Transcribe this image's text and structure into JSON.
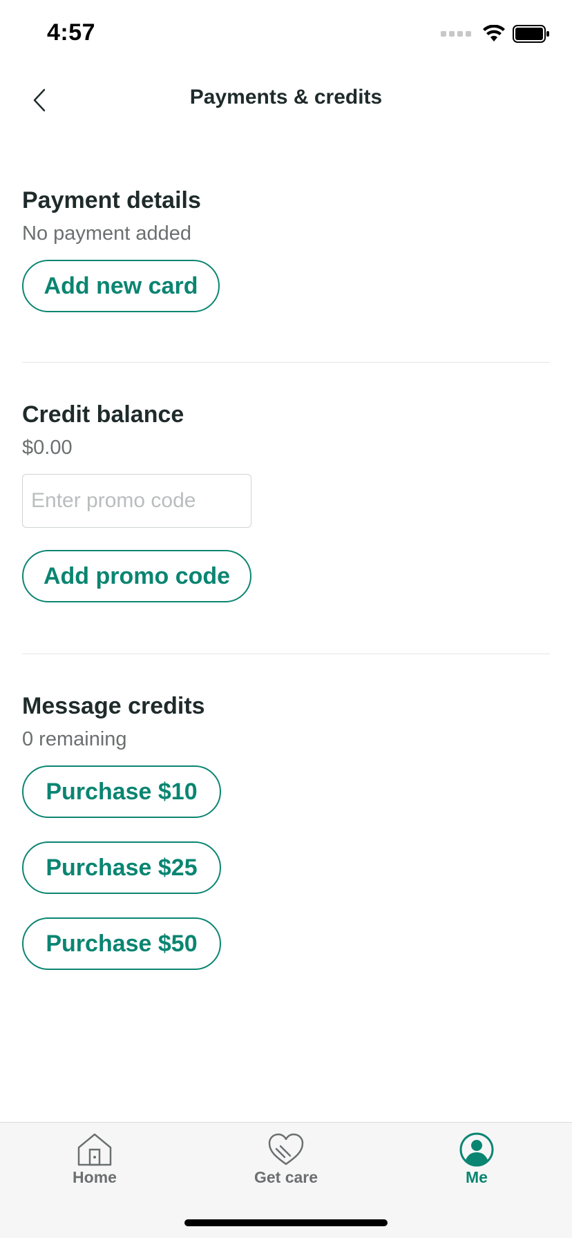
{
  "status_bar": {
    "time": "4:57",
    "icons": [
      "cellular-signal-icon",
      "wifi-icon",
      "battery-icon"
    ]
  },
  "nav": {
    "title": "Payments & credits",
    "back_icon": "chevron-left-icon"
  },
  "payment_details": {
    "title": "Payment details",
    "status": "No payment added",
    "add_card_label": "Add new card"
  },
  "credit_balance": {
    "title": "Credit balance",
    "amount": "$0.00",
    "promo_input_value": "",
    "promo_placeholder": "Enter promo code",
    "add_promo_label": "Add promo code"
  },
  "message_credits": {
    "title": "Message credits",
    "remaining": "0 remaining",
    "purchase_options": [
      {
        "label": "Purchase $10"
      },
      {
        "label": "Purchase $25"
      },
      {
        "label": "Purchase $50"
      }
    ]
  },
  "tab_bar": {
    "tabs": [
      {
        "label": "Home",
        "icon": "home-icon",
        "active": false
      },
      {
        "label": "Get care",
        "icon": "heart-hands-icon",
        "active": false
      },
      {
        "label": "Me",
        "icon": "user-icon",
        "active": true
      }
    ]
  },
  "colors": {
    "accent": "#0a8571",
    "text_primary": "#1f2a2b",
    "text_secondary": "#6b6f70",
    "divider": "#e3e5e5",
    "tab_bar_bg": "#f6f6f6"
  }
}
